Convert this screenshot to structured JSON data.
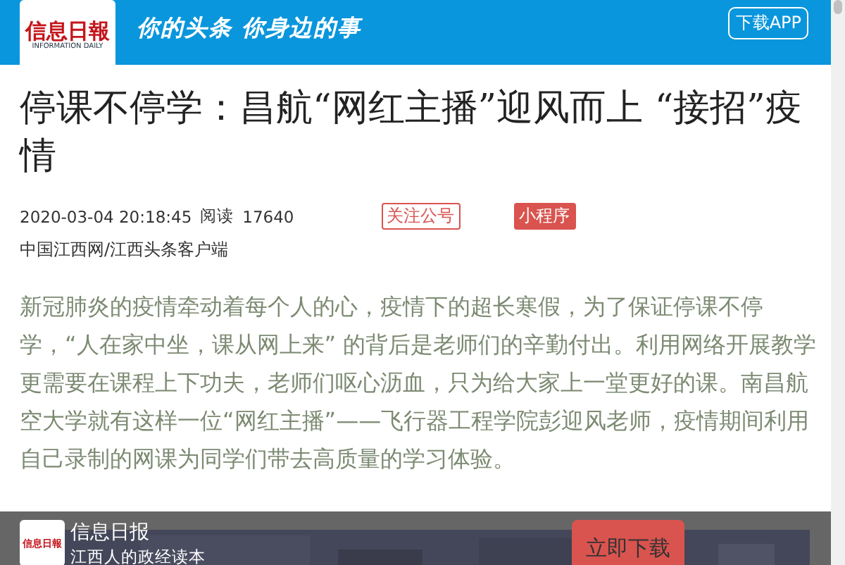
{
  "header": {
    "logo_text": "信息日報",
    "logo_subtitle": "INFORMATION DAILY",
    "slogan": "你的头条 你身边的事",
    "download_button": "下载APP"
  },
  "article": {
    "title": "停课不停学：昌航“网红主播”迎风而上 “接招”疫情",
    "date": "2020-03-04 20:18:45",
    "reads_label": "阅读",
    "reads": "17640",
    "follow_button": "关注公号",
    "mini_program_button": "小程序",
    "source": "中国江西网/江西头条客户端",
    "body": "新冠肺炎的疫情牵动着每个人的心，疫情下的超长寒假，为了保证停课不停学，“人在家中坐，课从网上来” 的背后是老师们的辛勤付出。利用网络开展教学更需要在课程上下功夫，老师们呕心沥血，只为给大家上一堂更好的课。南昌航空大学就有这样一位“网红主播”——飞行器工程学院彭迎风老师，疫情期间利用自己录制的网课为同学们带去高质量的学习体验。"
  },
  "app_banner": {
    "logo_text": "信息日報",
    "name": "信息日报",
    "tagline": "江西人的政经读本",
    "download_button": "立即下载"
  }
}
